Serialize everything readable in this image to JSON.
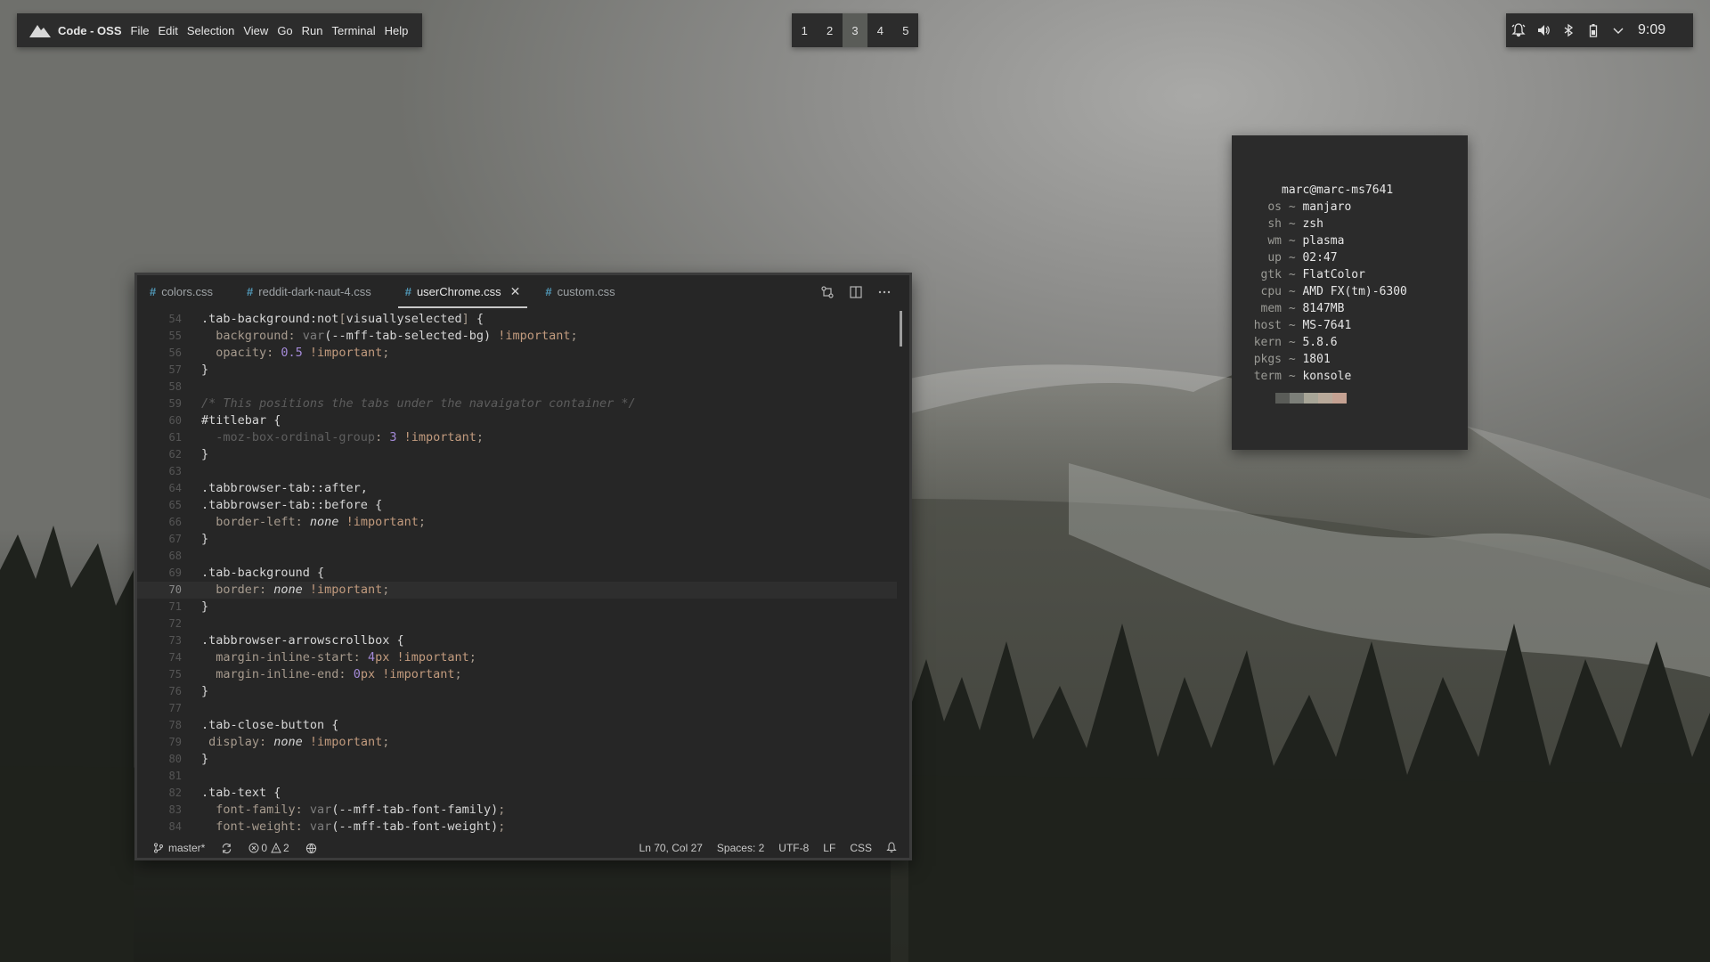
{
  "menubar": {
    "app_name": "Code - OSS",
    "items": [
      "File",
      "Edit",
      "Selection",
      "View",
      "Go",
      "Run",
      "Terminal",
      "Help"
    ]
  },
  "workspaces": {
    "items": [
      "1",
      "2",
      "3",
      "4",
      "5"
    ],
    "active": "3"
  },
  "tray": {
    "icons": [
      "notification-bell-icon",
      "volume-icon",
      "bluetooth-icon",
      "battery-icon",
      "chevron-down-icon"
    ],
    "clock": "9:09"
  },
  "neofetch": {
    "user_host": "marc@marc-ms7641",
    "entries": [
      {
        "key": "os",
        "value": "manjaro"
      },
      {
        "key": "sh",
        "value": "zsh"
      },
      {
        "key": "wm",
        "value": "plasma"
      },
      {
        "key": "up",
        "value": "02:47"
      },
      {
        "key": "gtk",
        "value": "FlatColor"
      },
      {
        "key": "cpu",
        "value": "AMD FX(tm)-6300"
      },
      {
        "key": "mem",
        "value": "8147MB"
      },
      {
        "key": "host",
        "value": "MS-7641"
      },
      {
        "key": "kern",
        "value": "5.8.6"
      },
      {
        "key": "pkgs",
        "value": "1801"
      },
      {
        "key": "term",
        "value": "konsole"
      }
    ],
    "separator": "~",
    "palette": [
      "#5a5c58",
      "#7c7f79",
      "#a7a597",
      "#b8a99a",
      "#c4a192"
    ]
  },
  "editor": {
    "tabs": [
      {
        "label": "colors.css",
        "active": false
      },
      {
        "label": "reddit-dark-naut-4.css",
        "active": false
      },
      {
        "label": "userChrome.css",
        "active": true
      },
      {
        "label": "custom.css",
        "active": false
      }
    ],
    "close_symbol": "✕",
    "current_line": 70,
    "lines": [
      {
        "n": "54",
        "segs": [
          {
            "c": "sel",
            "t": ".tab-background"
          },
          {
            "c": "val",
            "t": ":not"
          },
          {
            "c": "prop",
            "t": "["
          },
          {
            "c": "sel",
            "t": "visuallyselected"
          },
          {
            "c": "prop",
            "t": "]"
          },
          {
            "c": "sel",
            "t": " {"
          }
        ]
      },
      {
        "n": "55",
        "segs": [
          {
            "c": "prop",
            "t": "  background: "
          },
          {
            "c": "fn",
            "t": "var"
          },
          {
            "c": "val",
            "t": "(--mff-tab-selected-bg) "
          },
          {
            "c": "kw",
            "t": "!important"
          },
          {
            "c": "prop",
            "t": ";"
          }
        ]
      },
      {
        "n": "56",
        "segs": [
          {
            "c": "prop",
            "t": "  opacity: "
          },
          {
            "c": "num",
            "t": "0.5 "
          },
          {
            "c": "kw",
            "t": "!important"
          },
          {
            "c": "prop",
            "t": ";"
          }
        ]
      },
      {
        "n": "57",
        "segs": [
          {
            "c": "sel",
            "t": "}"
          }
        ]
      },
      {
        "n": "58",
        "segs": []
      },
      {
        "n": "59",
        "segs": [
          {
            "c": "cm",
            "t": "/* This positions the tabs under the navaigator container */"
          }
        ]
      },
      {
        "n": "60",
        "segs": [
          {
            "c": "sel",
            "t": "#titlebar {"
          }
        ]
      },
      {
        "n": "61",
        "segs": [
          {
            "c": "dim",
            "t": "  -moz-box-ordinal-group"
          },
          {
            "c": "prop",
            "t": ": "
          },
          {
            "c": "num",
            "t": "3 "
          },
          {
            "c": "kw",
            "t": "!important"
          },
          {
            "c": "prop",
            "t": ";"
          }
        ]
      },
      {
        "n": "62",
        "segs": [
          {
            "c": "sel",
            "t": "}"
          }
        ]
      },
      {
        "n": "63",
        "segs": []
      },
      {
        "n": "64",
        "segs": [
          {
            "c": "sel",
            "t": ".tabbrowser-tab::after,"
          }
        ]
      },
      {
        "n": "65",
        "segs": [
          {
            "c": "sel",
            "t": ".tabbrowser-tab::before {"
          }
        ]
      },
      {
        "n": "66",
        "segs": [
          {
            "c": "prop",
            "t": "  border-left: "
          },
          {
            "c": "val it",
            "t": "none "
          },
          {
            "c": "kw",
            "t": "!important"
          },
          {
            "c": "prop",
            "t": ";"
          }
        ]
      },
      {
        "n": "67",
        "segs": [
          {
            "c": "sel",
            "t": "}"
          }
        ]
      },
      {
        "n": "68",
        "segs": []
      },
      {
        "n": "69",
        "segs": [
          {
            "c": "sel",
            "t": ".tab-background {"
          }
        ]
      },
      {
        "n": "70",
        "segs": [
          {
            "c": "prop",
            "t": "  border: "
          },
          {
            "c": "val it",
            "t": "none "
          },
          {
            "c": "kw",
            "t": "!important"
          },
          {
            "c": "prop",
            "t": ";"
          }
        ]
      },
      {
        "n": "71",
        "segs": [
          {
            "c": "sel",
            "t": "}"
          }
        ]
      },
      {
        "n": "72",
        "segs": []
      },
      {
        "n": "73",
        "segs": [
          {
            "c": "sel",
            "t": ".tabbrowser-arrowscrollbox {"
          }
        ]
      },
      {
        "n": "74",
        "segs": [
          {
            "c": "prop",
            "t": "  margin-inline-start: "
          },
          {
            "c": "num",
            "t": "4"
          },
          {
            "c": "kw",
            "t": "px !important"
          },
          {
            "c": "prop",
            "t": ";"
          }
        ]
      },
      {
        "n": "75",
        "segs": [
          {
            "c": "prop",
            "t": "  margin-inline-end: "
          },
          {
            "c": "num",
            "t": "0"
          },
          {
            "c": "kw",
            "t": "px !important"
          },
          {
            "c": "prop",
            "t": ";"
          }
        ]
      },
      {
        "n": "76",
        "segs": [
          {
            "c": "sel",
            "t": "}"
          }
        ]
      },
      {
        "n": "77",
        "segs": []
      },
      {
        "n": "78",
        "segs": [
          {
            "c": "sel",
            "t": ".tab-close-button {"
          }
        ]
      },
      {
        "n": "79",
        "segs": [
          {
            "c": "prop",
            "t": " display: "
          },
          {
            "c": "val it",
            "t": "none "
          },
          {
            "c": "kw",
            "t": "!important"
          },
          {
            "c": "prop",
            "t": ";"
          }
        ]
      },
      {
        "n": "80",
        "segs": [
          {
            "c": "sel",
            "t": "}"
          }
        ]
      },
      {
        "n": "81",
        "segs": []
      },
      {
        "n": "82",
        "segs": [
          {
            "c": "sel",
            "t": ".tab-text {"
          }
        ]
      },
      {
        "n": "83",
        "segs": [
          {
            "c": "prop",
            "t": "  font-family: "
          },
          {
            "c": "fn",
            "t": "var"
          },
          {
            "c": "val",
            "t": "(--mff-tab-font-family)"
          },
          {
            "c": "prop",
            "t": ";"
          }
        ]
      },
      {
        "n": "84",
        "segs": [
          {
            "c": "prop",
            "t": "  font-weight: "
          },
          {
            "c": "fn",
            "t": "var"
          },
          {
            "c": "val",
            "t": "(--mff-tab-font-weight)"
          },
          {
            "c": "prop",
            "t": ";"
          }
        ]
      }
    ],
    "status": {
      "branch": "master*",
      "errors": "0",
      "warnings": "2",
      "position": "Ln 70, Col 27",
      "spaces": "Spaces: 2",
      "encoding": "UTF-8",
      "eol": "LF",
      "language": "CSS"
    }
  }
}
